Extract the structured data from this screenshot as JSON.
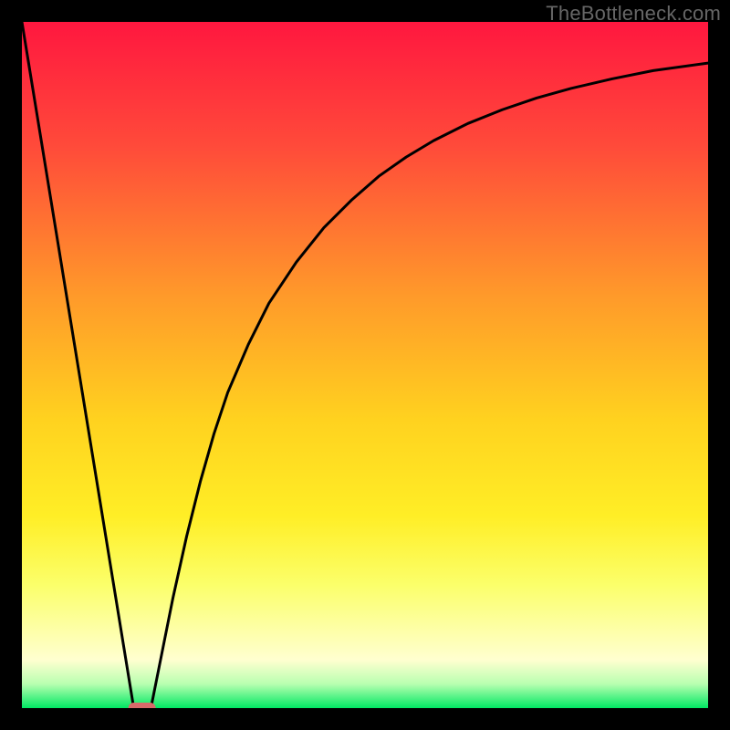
{
  "watermark": "TheBottleneck.com",
  "chart_data": {
    "type": "line",
    "title": "",
    "xlabel": "",
    "ylabel": "",
    "xlim": [
      0,
      100
    ],
    "ylim": [
      0,
      100
    ],
    "gradient_stops": [
      {
        "offset": 0,
        "color": "#ff173f"
      },
      {
        "offset": 0.18,
        "color": "#ff4a3a"
      },
      {
        "offset": 0.4,
        "color": "#ff9a2a"
      },
      {
        "offset": 0.58,
        "color": "#ffd21f"
      },
      {
        "offset": 0.72,
        "color": "#ffee26"
      },
      {
        "offset": 0.82,
        "color": "#fbff6a"
      },
      {
        "offset": 0.93,
        "color": "#ffffd0"
      },
      {
        "offset": 0.965,
        "color": "#b8ffb0"
      },
      {
        "offset": 1.0,
        "color": "#00e863"
      }
    ],
    "series": [
      {
        "name": "left-line",
        "x": [
          0,
          16.3
        ],
        "values": [
          100,
          0
        ]
      },
      {
        "name": "right-curve",
        "x": [
          18.8,
          20,
          22,
          24,
          26,
          28,
          30,
          33,
          36,
          40,
          44,
          48,
          52,
          56,
          60,
          65,
          70,
          75,
          80,
          86,
          92,
          100
        ],
        "values": [
          0,
          6,
          16,
          25,
          33,
          40,
          46,
          53,
          59,
          65,
          70,
          74,
          77.5,
          80.3,
          82.7,
          85.2,
          87.2,
          88.9,
          90.3,
          91.7,
          92.9,
          94.0
        ]
      }
    ],
    "marker": {
      "name": "min-marker",
      "x": 17.5,
      "y": 0,
      "width_pct": 4.0,
      "height_pct": 1.6,
      "color": "#d86a6a"
    }
  }
}
